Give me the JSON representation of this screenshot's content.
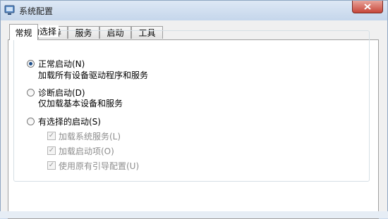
{
  "window": {
    "title": "系统配置",
    "close_symbol": "x"
  },
  "tabs": [
    {
      "label": "常规",
      "active": true
    },
    {
      "label": "引导",
      "active": false
    },
    {
      "label": "服务",
      "active": false
    },
    {
      "label": "启动",
      "active": false
    },
    {
      "label": "工具",
      "active": false
    }
  ],
  "startup_group": {
    "legend": "启动选择",
    "options": [
      {
        "label": "正常启动(N)",
        "description": "加载所有设备驱动程序和服务",
        "selected": true
      },
      {
        "label": "诊断启动(D)",
        "description": "仅加载基本设备和服务",
        "selected": false
      },
      {
        "label": "有选择的启动(S)",
        "selected": false
      }
    ],
    "selective_items": [
      {
        "label": "加载系统服务(L)",
        "checked": true,
        "enabled": false
      },
      {
        "label": "加载启动项(O)",
        "checked": true,
        "enabled": false
      },
      {
        "label": "使用原有引导配置(U)",
        "checked": true,
        "enabled": false
      }
    ]
  },
  "colors": {
    "accent": "#1f4f8a",
    "disabled_text": "#8d8d8d"
  }
}
